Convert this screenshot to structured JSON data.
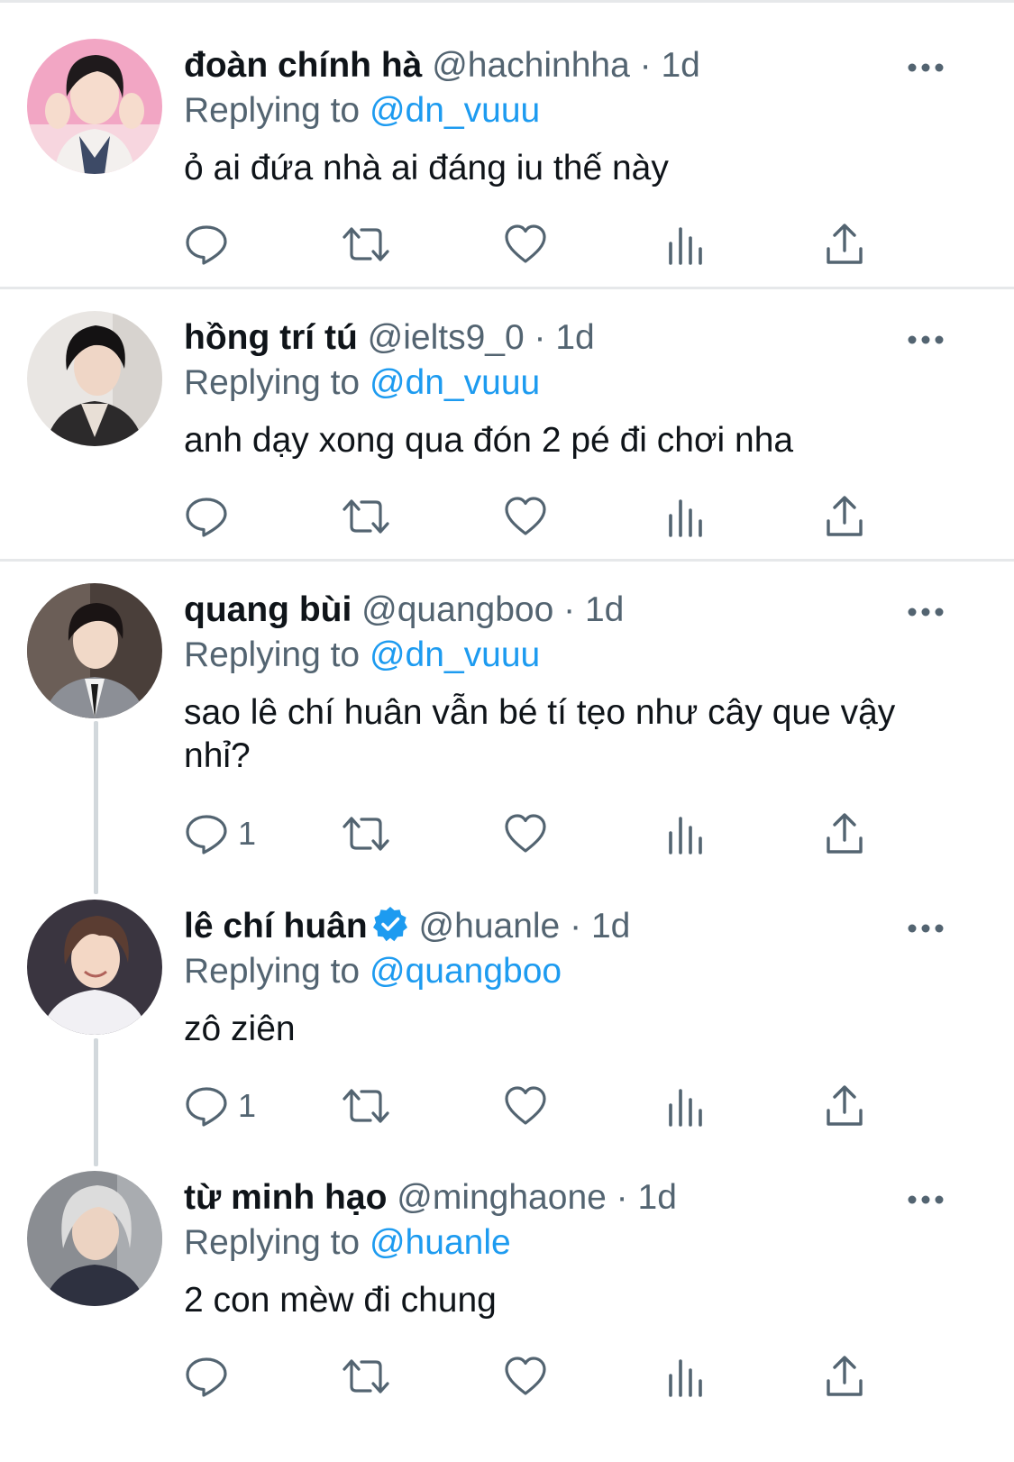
{
  "tweets": [
    {
      "name": "đoàn chính hà",
      "handle": "@hachinhha",
      "dot": "·",
      "time": "1d",
      "replying_prefix": "Replying to",
      "replying_to": "@dn_vuuu",
      "text": "ỏ ai đứa nhà ai đáng iu thế này",
      "reply_count": "",
      "verified": false
    },
    {
      "name": "hồng trí tú",
      "handle": "@ielts9_0",
      "dot": "·",
      "time": "1d",
      "replying_prefix": "Replying to",
      "replying_to": "@dn_vuuu",
      "text": "anh dạy xong qua đón 2 pé đi chơi nha",
      "reply_count": "",
      "verified": false
    },
    {
      "name": "quang bùi",
      "handle": "@quangboo",
      "dot": "·",
      "time": "1d",
      "replying_prefix": "Replying to",
      "replying_to": "@dn_vuuu",
      "text": "sao lê chí huân vẫn bé tí tẹo như cây que vậy nhỉ?",
      "reply_count": "1",
      "verified": false
    },
    {
      "name": "lê chí huân",
      "handle": "@huanle",
      "dot": "·",
      "time": "1d",
      "replying_prefix": "Replying to",
      "replying_to": "@quangboo",
      "text": "zô ziên",
      "reply_count": "1",
      "verified": true
    },
    {
      "name": "từ minh hạo",
      "handle": "@minghaone",
      "dot": "·",
      "time": "1d",
      "replying_prefix": "Replying to",
      "replying_to": "@huanle",
      "text": "2 con mèw đi chung",
      "reply_count": "",
      "verified": false
    }
  ],
  "icons": {
    "reply": "reply-icon",
    "retweet": "retweet-icon",
    "like": "heart-icon",
    "views": "views-icon",
    "share": "share-icon",
    "more": "more-icon",
    "verified": "verified-badge-icon"
  },
  "colors": {
    "text": "#0f1419",
    "secondary": "#536471",
    "accent": "#1d9bf0",
    "divider": "#e6e8ea",
    "thread_line": "#d2d8dc"
  }
}
